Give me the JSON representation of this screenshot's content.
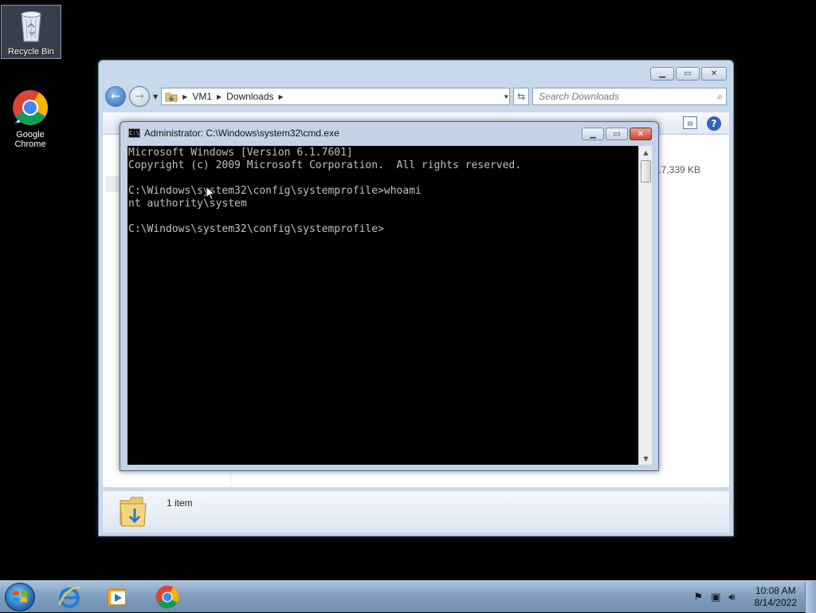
{
  "desktop": {
    "icons": [
      {
        "label": "Recycle Bin",
        "icon": "recycle-bin-icon"
      },
      {
        "label": "Google Chrome",
        "icon": "chrome-icon"
      }
    ]
  },
  "explorer": {
    "breadcrumb": [
      "VM1",
      "Downloads"
    ],
    "search_placeholder": "Search Downloads",
    "file_size_partial": "17,339 KB",
    "status": "1 item"
  },
  "cmd": {
    "title": "Administrator: C:\\Windows\\system32\\cmd.exe",
    "output": "Microsoft Windows [Version 6.1.7601]\nCopyright (c) 2009 Microsoft Corporation.  All rights reserved.\n\nC:\\Windows\\system32\\config\\systemprofile>whoami\nnt authority\\system\n\nC:\\Windows\\system32\\config\\systemprofile>"
  },
  "taskbar": {
    "apps": [
      "internet-explorer-icon",
      "media-player-icon",
      "chrome-icon"
    ],
    "time": "10:08 AM",
    "date": "8/14/2022"
  },
  "colors": {
    "console_bg": "#000000",
    "console_text": "#c0c0c0",
    "close_red": "#c74a32"
  }
}
